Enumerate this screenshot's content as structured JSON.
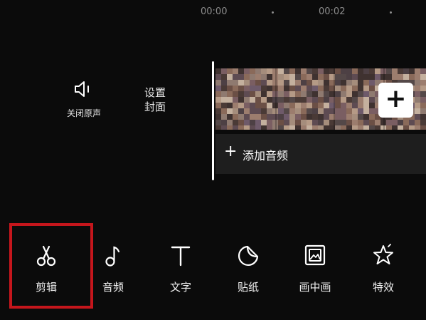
{
  "timeline": {
    "timestamps": [
      "00:00",
      "00:02"
    ]
  },
  "left_controls": {
    "mute_label": "关闭原声",
    "cover_line1": "设置",
    "cover_line2": "封面"
  },
  "clip_track": {
    "add_icon": "plus-icon"
  },
  "audio_track": {
    "label": "添加音频"
  },
  "toolbar": {
    "items": [
      {
        "label": "剪辑",
        "icon": "scissors-icon"
      },
      {
        "label": "音频",
        "icon": "music-note-icon"
      },
      {
        "label": "文字",
        "icon": "text-icon"
      },
      {
        "label": "贴纸",
        "icon": "sticker-icon"
      },
      {
        "label": "画中画",
        "icon": "picture-in-picture-icon"
      },
      {
        "label": "特效",
        "icon": "star-effect-icon"
      }
    ]
  },
  "colors": {
    "background": "#0b0b0b",
    "highlight": "#c5161c",
    "track_bg": "#1e1e1e"
  }
}
